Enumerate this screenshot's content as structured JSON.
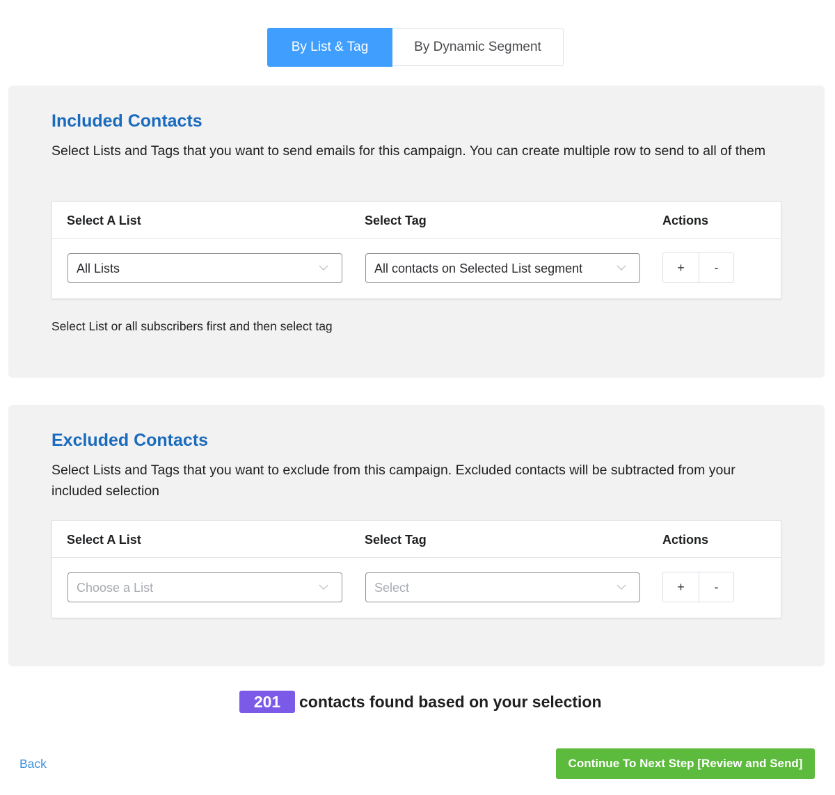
{
  "tabs": [
    {
      "label": "By List & Tag",
      "active": true
    },
    {
      "label": "By Dynamic Segment",
      "active": false
    }
  ],
  "included": {
    "title": "Included Contacts",
    "description": "Select Lists and Tags that you want to send emails for this campaign. You can create multiple row to send to all of them",
    "columns": [
      "Select A List",
      "Select Tag",
      "Actions"
    ],
    "row": {
      "list_value": "All Lists",
      "tag_value": "All contacts on Selected List segment",
      "add_label": "+",
      "remove_label": "-"
    },
    "hint": "Select List or all subscribers first and then select tag"
  },
  "excluded": {
    "title": "Excluded Contacts",
    "description": "Select Lists and Tags that you want to exclude from this campaign. Excluded contacts will be subtracted from your included selection",
    "columns": [
      "Select A List",
      "Select Tag",
      "Actions"
    ],
    "row": {
      "list_placeholder": "Choose a List",
      "tag_placeholder": "Select",
      "add_label": "+",
      "remove_label": "-"
    }
  },
  "summary": {
    "count": "201",
    "text": "contacts found based on your selection"
  },
  "footer": {
    "back_label": "Back",
    "continue_label": "Continue To Next Step [Review and Send]"
  },
  "icons": {
    "dropdown": "chevron-down-icon"
  },
  "colors": {
    "primary": "#409eff",
    "title": "#1a6bbd",
    "badge": "#7a5ae6",
    "success": "#5cbb3c",
    "link": "#3b8ee0",
    "panel_bg": "#f2f2f2"
  }
}
